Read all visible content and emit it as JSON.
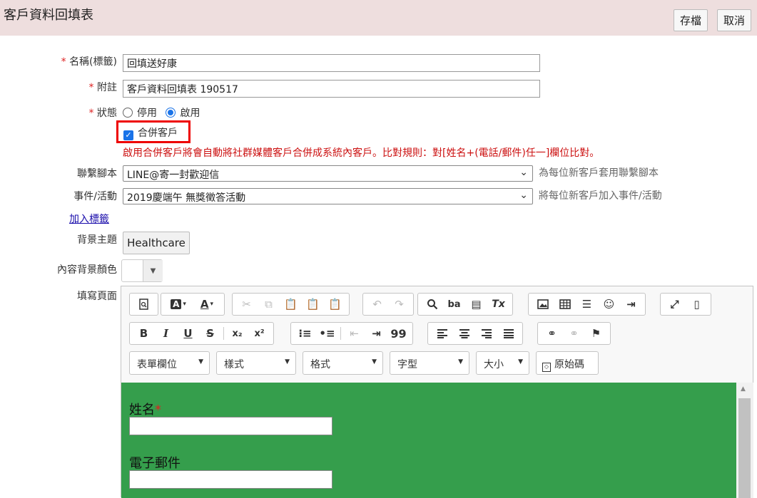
{
  "header": {
    "title": "客戶資料回填表",
    "save_label": "存檔",
    "cancel_label": "取消"
  },
  "form": {
    "name": {
      "label": "名稱(標籤)",
      "value": "回填送好康",
      "required_mark": "*"
    },
    "note": {
      "label": "附註",
      "value": "客戶資料回填表 190517",
      "required_mark": "*"
    },
    "status": {
      "label": "狀態",
      "required_mark": "*",
      "options": [
        "停用",
        "啟用"
      ],
      "selected": "啟用"
    },
    "merge": {
      "label": "合併客戶",
      "checked": true,
      "warning": "啟用合併客戶將會自動將社群媒體客戶合併成系統內客戶。比對規則：對[姓名+(電話/郵件)任一]欄位比對。"
    },
    "script": {
      "label": "聯繫腳本",
      "value": "LINE@寄一封歡迎信",
      "hint": "為每位新客戶套用聯繫腳本"
    },
    "event": {
      "label": "事件/活動",
      "value": "2019慶端午 無獎徵答活動",
      "hint": "將每位新客戶加入事件/活動"
    },
    "add_tag_link": "加入標籤",
    "theme": {
      "label": "背景主題",
      "value": "Healthcare"
    },
    "bg_color": {
      "label": "內容背景顏色"
    },
    "page": {
      "label": "填寫頁面"
    }
  },
  "editor": {
    "combos": {
      "fields": "表單欄位",
      "styles": "樣式",
      "format": "格式",
      "font": "字型",
      "size": "大小",
      "source": "原始碼"
    },
    "toolbar_glyphs": {
      "bold": "B",
      "italic": "I",
      "underline": "U",
      "strike": "S",
      "subscript": "x₂",
      "superscript": "x²",
      "blockquote": "99",
      "text_color": "A",
      "bg_color": "A",
      "remove_format": "Tx",
      "find_replace": "ba"
    },
    "content_bg": "#359e4c",
    "fields": [
      {
        "label": "姓名",
        "required": "*"
      },
      {
        "label": "電子郵件"
      }
    ]
  },
  "colors": {
    "header_bg": "#eedede",
    "required": "#dd2222",
    "link": "#1a0dab",
    "accent": "#1a73e8",
    "highlight_border": "#ee0000"
  }
}
